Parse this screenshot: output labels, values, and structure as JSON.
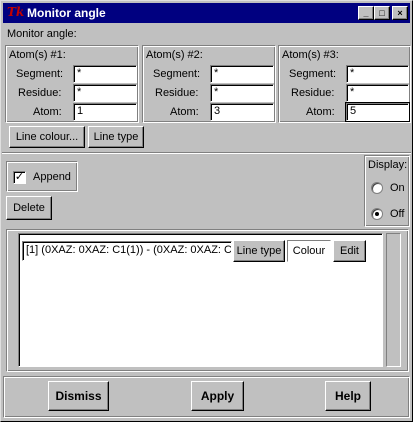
{
  "window": {
    "title": "Monitor angle",
    "icon": "tk-logo-icon",
    "logo_text": "Tk",
    "controls": {
      "minimize_glyph": "_",
      "maximize_glyph": "□",
      "close_glyph": "×"
    }
  },
  "header_label": "Monitor angle:",
  "atoms": [
    {
      "heading": "Atom(s) #1:",
      "segment_label": "Segment:",
      "segment_value": "*",
      "residue_label": "Residue:",
      "residue_value": "*",
      "atom_label": "Atom:",
      "atom_value": "1"
    },
    {
      "heading": "Atom(s) #2:",
      "segment_label": "Segment:",
      "segment_value": "*",
      "residue_label": "Residue:",
      "residue_value": "*",
      "atom_label": "Atom:",
      "atom_value": "3"
    },
    {
      "heading": "Atom(s) #3:",
      "segment_label": "Segment:",
      "segment_value": "*",
      "residue_label": "Residue:",
      "residue_value": "*",
      "atom_label": "Atom:",
      "atom_value": "5"
    }
  ],
  "style_buttons": {
    "line_colour": "Line colour...",
    "line_type": "Line type"
  },
  "append": {
    "label": "Append",
    "checked": true,
    "check_glyph": "✓"
  },
  "delete_label": "Delete",
  "display": {
    "label": "Display:",
    "on_label": "On",
    "off_label": "Off",
    "selected": "Off"
  },
  "monitor_list": [
    {
      "text": "[1] (0XAZ: 0XAZ: C1(1)) - (0XAZ: 0XAZ: C",
      "line_type_label": "Line type",
      "colour_label": "Colour",
      "edit_label": "Edit"
    }
  ],
  "footer": {
    "dismiss": "Dismiss",
    "apply": "Apply",
    "help": "Help"
  },
  "colors": {
    "titlebar": "#000080",
    "window_bg": "#c0c0c0",
    "logo": "#c00000"
  }
}
